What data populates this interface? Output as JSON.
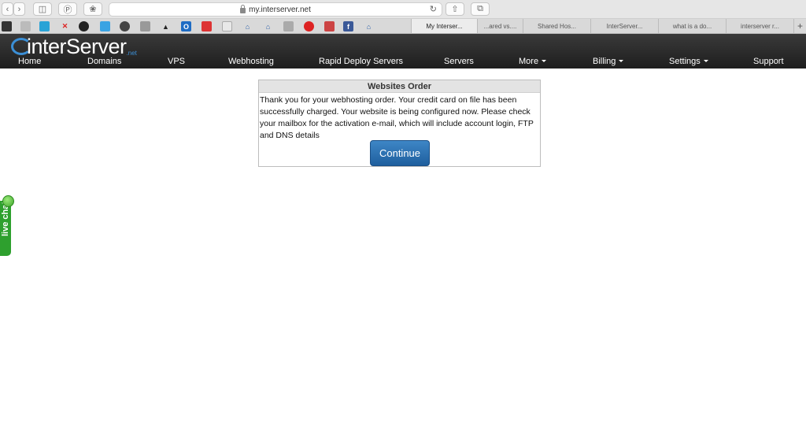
{
  "browser": {
    "url": "my.interserver.net",
    "tabs": [
      {
        "label": "My Interser..."
      },
      {
        "label": "...ared vs...."
      },
      {
        "label": "Shared Hos..."
      },
      {
        "label": "InterServer..."
      },
      {
        "label": "what is a do..."
      },
      {
        "label": "interserver r..."
      }
    ],
    "bookmark_icons": [
      "layers-icon",
      "circle-icon",
      "close-icon",
      "bird-icon",
      "gear-icon",
      "person-icon",
      "file-icon",
      "hat-icon",
      "mail-icon",
      "shield-icon",
      "doc-icon",
      "home-icon",
      "home-icon",
      "box-icon",
      "apple-icon",
      "image-icon",
      "facebook-icon",
      "home-icon"
    ]
  },
  "site": {
    "logo_text": "interServer",
    "logo_suffix": ".net",
    "nav": [
      {
        "label": "Home"
      },
      {
        "label": "Domains"
      },
      {
        "label": "VPS"
      },
      {
        "label": "Webhosting"
      },
      {
        "label": "Rapid Deploy Servers"
      },
      {
        "label": "Servers"
      },
      {
        "label": "More",
        "dropdown": true
      },
      {
        "label": "Billing",
        "dropdown": true
      },
      {
        "label": "Settings",
        "dropdown": true
      },
      {
        "label": "Support"
      }
    ]
  },
  "order": {
    "title": "Websites Order",
    "message": "Thank you for your webhosting order. Your credit card on file has been successfully charged. Your website is being configured now. Please check your mailbox for the activation e-mail, which will include account login, FTP and DNS details",
    "button_label": "Continue"
  },
  "live_chat": {
    "label": "live chat"
  },
  "colors": {
    "header_bg": "#2b2b2b",
    "accent_blue": "#2a6fb0",
    "chat_green": "#2ea02e"
  }
}
